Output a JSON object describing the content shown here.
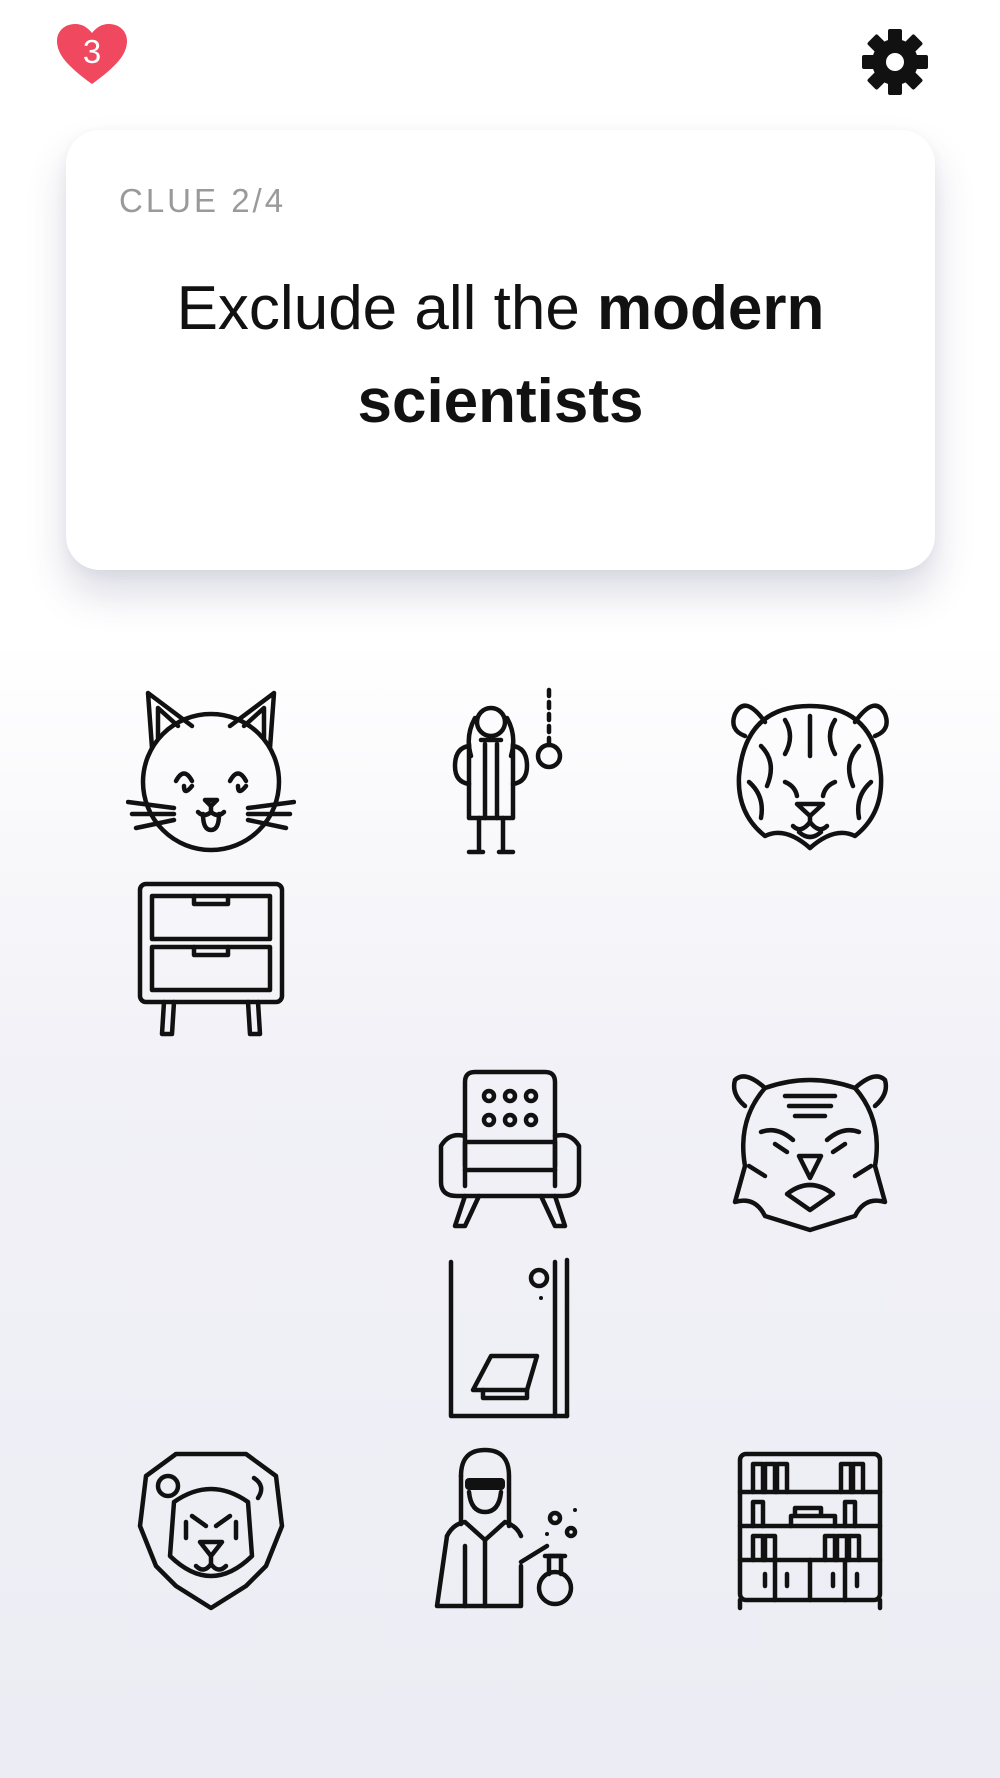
{
  "header": {
    "lives": "3",
    "lives_icon": "heart-icon",
    "settings_icon": "gear-icon",
    "heart_color": "#f0485e"
  },
  "clue": {
    "label": "CLUE 2/4",
    "text_regular": "Exclude all the ",
    "text_bold_1": "modern",
    "text_bold_2": "scientists"
  },
  "grid": {
    "tiles": [
      {
        "icon": "cat-icon"
      },
      {
        "icon": "scientist-pendulum-icon"
      },
      {
        "icon": "tiger-face-icon"
      },
      {
        "icon": "nightstand-icon"
      },
      {
        "icon": "armchair-icon"
      },
      {
        "icon": "tiger-head-icon"
      },
      {
        "icon": "fume-hood-icon"
      },
      {
        "icon": "lion-icon"
      },
      {
        "icon": "female-scientist-icon"
      },
      {
        "icon": "bookshelf-icon"
      }
    ]
  }
}
